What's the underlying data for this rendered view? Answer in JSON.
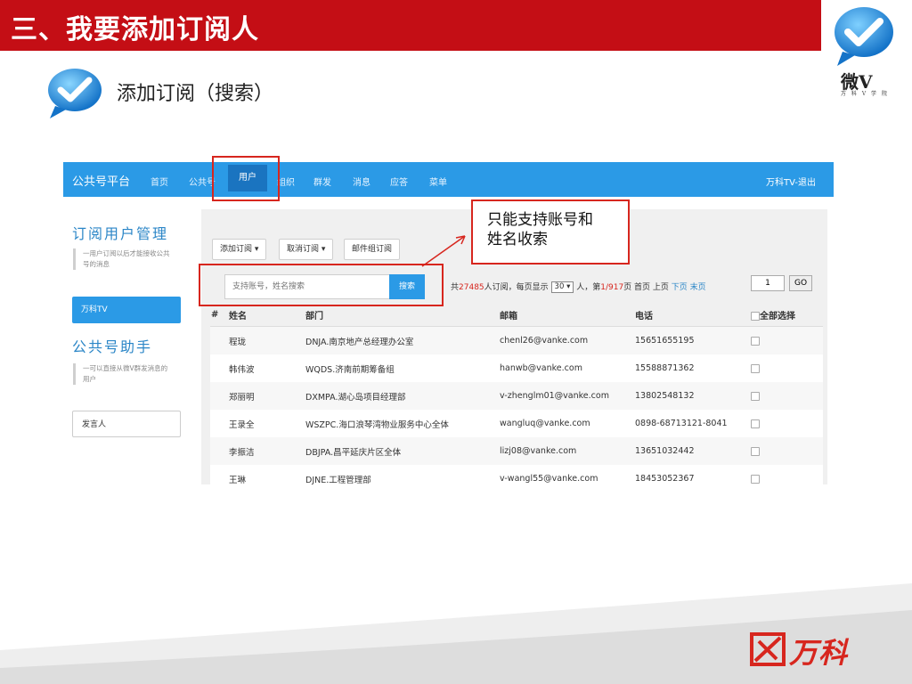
{
  "slide": {
    "title": "三、我要添加订阅人",
    "subtitle": "添加订阅（搜索）",
    "brand": "微V",
    "brand_sub": "万 科 V 学 院",
    "company": "万科",
    "accent": "#c40e15"
  },
  "app": {
    "nav": {
      "brand": "公共号平台",
      "items": [
        "首页",
        "公共号",
        "用户",
        "组织",
        "群发",
        "消息",
        "应答",
        "菜单"
      ],
      "active": "用户",
      "exit": "万科TV-退出"
    },
    "sidebar": {
      "title1": "订阅用户管理",
      "desc1": "一用户订阅以后才能接收公共号的消息",
      "active_item": "万科TV",
      "title2": "公共号助手",
      "desc2": "一可以直接从微V群发消息的用户",
      "plain_item": "发言人"
    },
    "toolbar": {
      "add": "添加订阅",
      "cancel": "取消订阅",
      "mail_group": "邮件组订阅"
    },
    "search": {
      "placeholder": "支持账号，姓名搜索",
      "button": "搜索"
    },
    "pager": {
      "prefix": "共",
      "total": "27485",
      "mid1": "人订阅，每页显示",
      "per_page": "30",
      "mid2": "人，第",
      "page": "1/917",
      "mid3": "页 首页 上页",
      "next": "下页",
      "last": "末页",
      "current": "1",
      "go": "GO"
    },
    "table": {
      "headers": [
        "#",
        "姓名",
        "部门",
        "邮箱",
        "电话",
        "全部选择"
      ],
      "rows": [
        {
          "name": "程珑",
          "dept": "DNJA.南京地产总经理办公室",
          "email": "chenl26@vanke.com",
          "phone": "15651655195"
        },
        {
          "name": "韩伟波",
          "dept": "WQDS.济南前期筹备组",
          "email": "hanwb@vanke.com",
          "phone": "15588871362"
        },
        {
          "name": "郑丽明",
          "dept": "DXMPA.湖心岛项目经理部",
          "email": "v-zhenglm01@vanke.com",
          "phone": "13802548132"
        },
        {
          "name": "王录全",
          "dept": "WSZPC.海口浪琴湾物业服务中心全体",
          "email": "wangluq@vanke.com",
          "phone": "0898-68713121-8041"
        },
        {
          "name": "李振洁",
          "dept": "DBJPA.昌平延庆片区全体",
          "email": "lizj08@vanke.com",
          "phone": "13651032442"
        },
        {
          "name": "王琳",
          "dept": "DJNE.工程管理部",
          "email": "v-wangl55@vanke.com",
          "phone": "18453052367"
        }
      ]
    }
  },
  "callout": {
    "line1": "只能支持账号和",
    "line2": "姓名收索"
  }
}
